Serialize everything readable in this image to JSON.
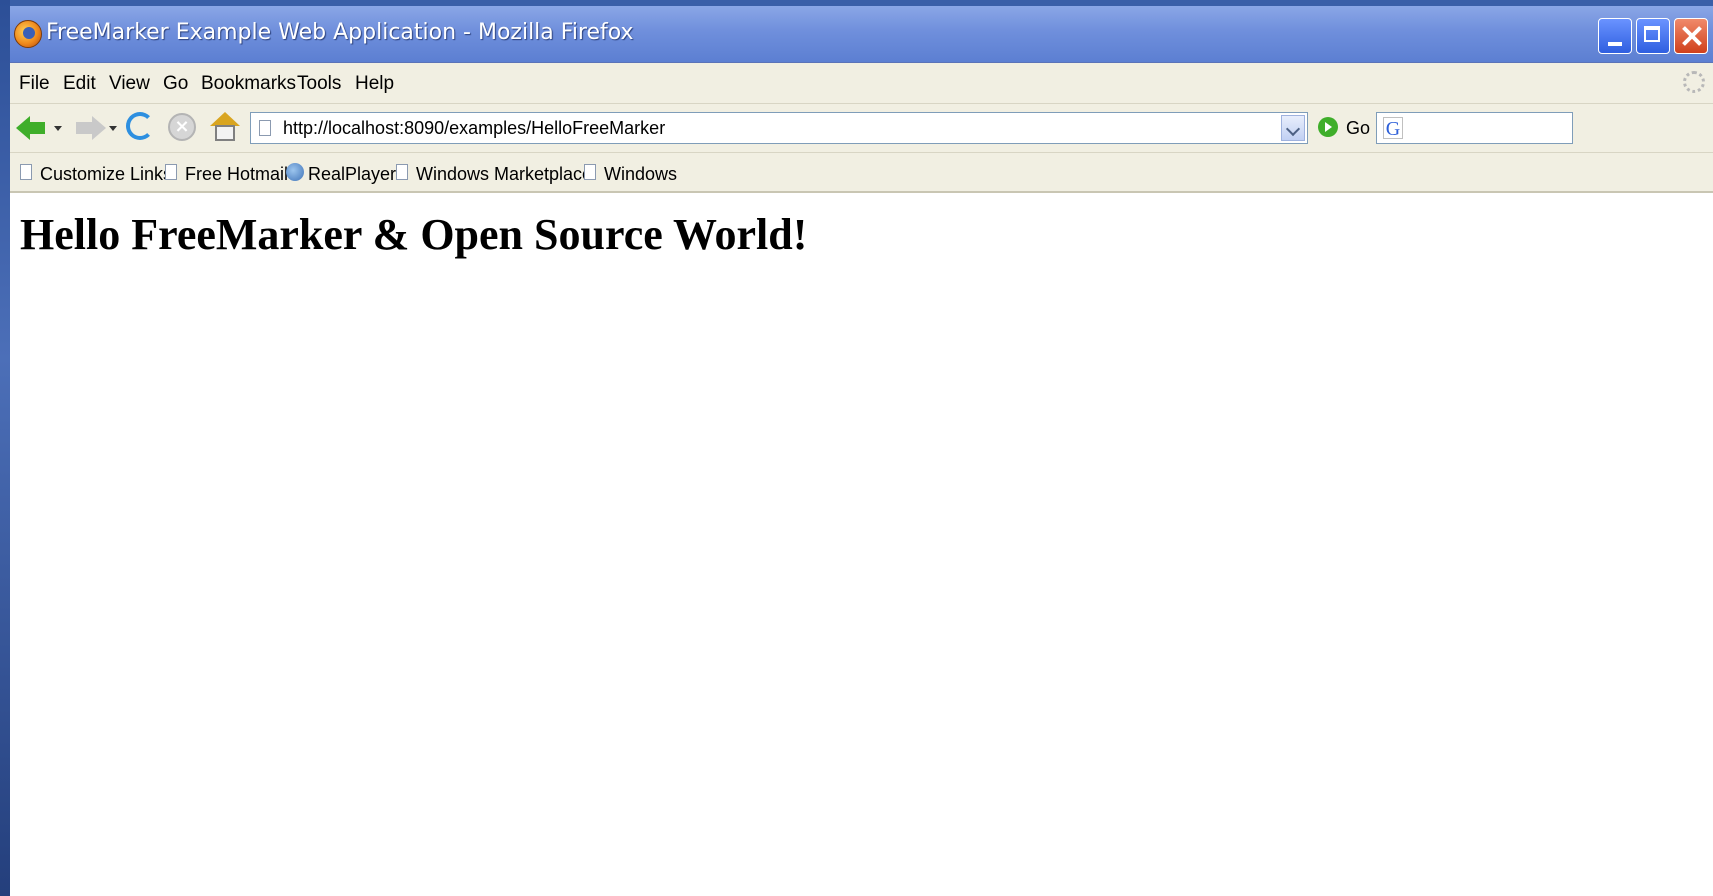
{
  "window": {
    "title": "FreeMarker Example Web Application - Mozilla Firefox"
  },
  "menu": {
    "items": [
      "File",
      "Edit",
      "View",
      "Go",
      "Bookmarks",
      "Tools",
      "Help"
    ]
  },
  "navigation": {
    "url": "http://localhost:8090/examples/HelloFreeMarker",
    "go_label": "Go"
  },
  "links": {
    "items": [
      "Customize Links",
      "Free Hotmail",
      "RealPlayer",
      "Windows Marketplace",
      "Windows"
    ]
  },
  "page": {
    "heading": "Hello FreeMarker & Open Source World!"
  },
  "icons": {
    "browser": "firefox-icon",
    "back": "back-arrow-icon",
    "forward": "forward-arrow-icon",
    "reload": "reload-icon",
    "stop": "stop-icon",
    "home": "home-icon",
    "go": "go-icon",
    "search_engine": "google-icon"
  },
  "colors": {
    "titlebar": "#6f8fdc",
    "toolbar": "#f1efe2",
    "back_arrow": "#3fae2a"
  }
}
